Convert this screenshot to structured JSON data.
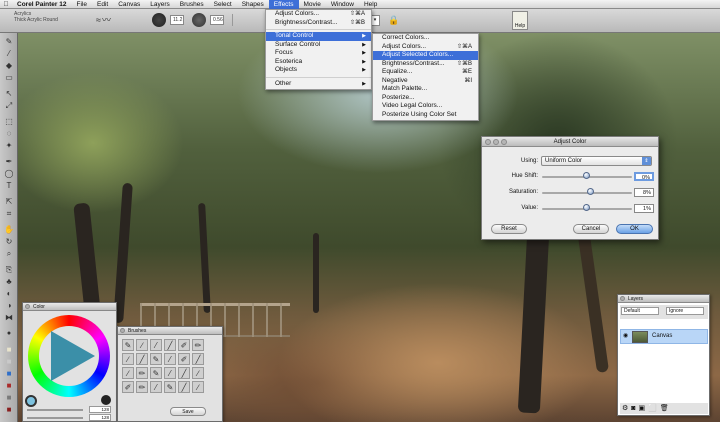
{
  "menubar": {
    "apple": "",
    "app_name": "Corel Painter 12",
    "items": [
      "File",
      "Edit",
      "Canvas",
      "Layers",
      "Brushes",
      "Select",
      "Shapes",
      "Effects",
      "Movie",
      "Window",
      "Help"
    ],
    "active": "Effects"
  },
  "propbar": {
    "brush_category": "Acrylics",
    "brush_variant": "Thick Acrylic Round",
    "size_value": "11.2",
    "opacity_value": "0.56",
    "help_label": "Help"
  },
  "effects_menu": {
    "items": [
      {
        "label": "Adjust Colors...",
        "shortcut": "⇧⌘A"
      },
      {
        "label": "Brightness/Contrast...",
        "shortcut": "⇧⌘B"
      },
      {
        "label": "Tonal Control",
        "submenu": true,
        "selected": true
      },
      {
        "label": "Surface Control",
        "submenu": true
      },
      {
        "label": "Focus",
        "submenu": true
      },
      {
        "label": "Esoterica",
        "submenu": true
      },
      {
        "label": "Objects",
        "submenu": true
      },
      {
        "label": "Other",
        "submenu": true
      }
    ]
  },
  "tonal_submenu": {
    "items": [
      {
        "label": "Correct Colors...",
        "shortcut": ""
      },
      {
        "label": "Adjust Colors...",
        "shortcut": "⇧⌘A"
      },
      {
        "label": "Adjust Selected Colors...",
        "shortcut": "",
        "selected": true
      },
      {
        "label": "Brightness/Contrast...",
        "shortcut": "⇧⌘B"
      },
      {
        "label": "Equalize...",
        "shortcut": "⌘E"
      },
      {
        "label": "Negative",
        "shortcut": "⌘I"
      },
      {
        "label": "Match Palette...",
        "shortcut": ""
      },
      {
        "label": "Posterize...",
        "shortcut": ""
      },
      {
        "label": "Video Legal Colors...",
        "shortcut": ""
      },
      {
        "label": "Posterize Using Color Set",
        "shortcut": ""
      }
    ]
  },
  "dialog": {
    "title": "Adjust Color",
    "using_label": "Using:",
    "using_value": "Uniform Color",
    "hue_label": "Hue Shift:",
    "hue_value": "0%",
    "saturation_label": "Saturation:",
    "saturation_value": "8%",
    "value_label": "Value:",
    "value_value": "1%",
    "reset": "Reset",
    "cancel": "Cancel",
    "ok": "OK",
    "hue_level": 0.5,
    "saturation_level": 0.54,
    "value_level": 0.5
  },
  "color_panel": {
    "title": "Color",
    "value_1": "128",
    "value_2": "128"
  },
  "brush_panel": {
    "title": "Brushes",
    "save_label": "Save"
  },
  "layers_panel": {
    "title": "Layers",
    "composite": "Default",
    "mode": "Ignore",
    "layer_name": "Canvas"
  },
  "colors": {
    "accent": "#3d6fd8",
    "selection": "#3d6fd8",
    "layer_selected": "#b9d6f7"
  }
}
